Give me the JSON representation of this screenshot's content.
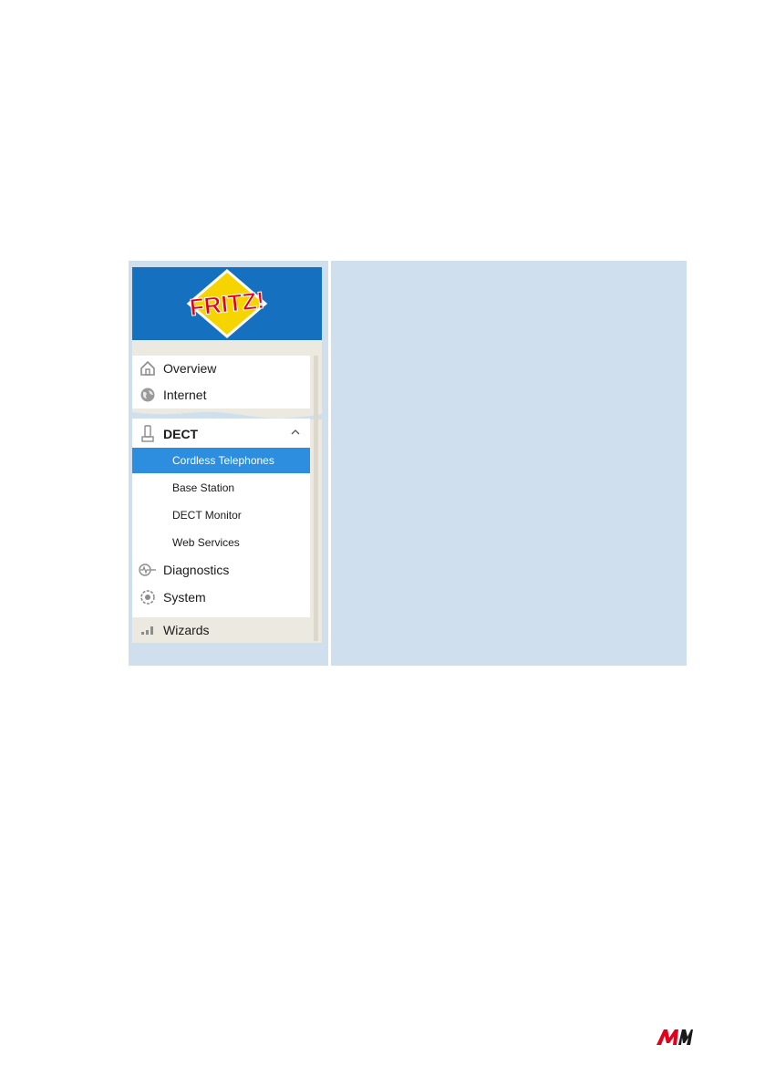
{
  "logo": {
    "text": "FRITZ!"
  },
  "nav": {
    "overview": "Overview",
    "internet": "Internet",
    "dect": "DECT",
    "dect_sub": [
      "Cordless Telephones",
      "Base Station",
      "DECT Monitor",
      "Web Services"
    ],
    "diagnostics": "Diagnostics",
    "system": "System",
    "wizards": "Wizards"
  },
  "colors": {
    "header_blue": "#1570c0",
    "active_blue": "#2d8ee0",
    "content_bg": "#cfdfee",
    "aim_red": "#e2001a"
  },
  "footer": {
    "brand": "AVM"
  }
}
